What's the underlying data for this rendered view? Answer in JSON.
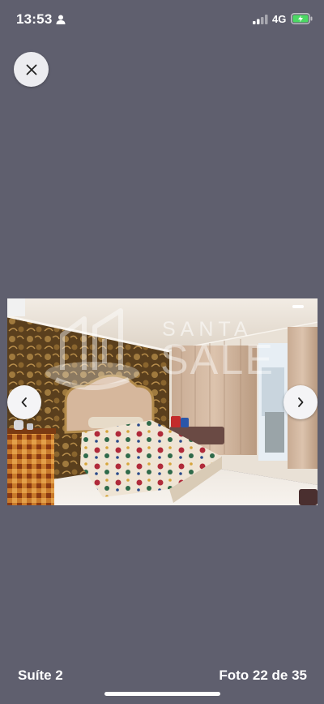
{
  "status_bar": {
    "time": "13:53",
    "network": "4G",
    "icons": [
      "person-icon",
      "signal-icon",
      "battery-charging-icon"
    ]
  },
  "viewer": {
    "close_icon": "close-icon",
    "prev_icon": "chevron-left-icon",
    "next_icon": "chevron-right-icon",
    "watermark_top": "SANTA",
    "watermark_bottom": "SALE",
    "photo_subject": "bedroom-photo"
  },
  "footer": {
    "caption": "Suíte 2",
    "counter": "Foto 22 de 35"
  },
  "colors": {
    "background": "#5f5f6e",
    "button": "#f4f4f6",
    "text": "#ffffff",
    "battery": "#4cd964"
  }
}
